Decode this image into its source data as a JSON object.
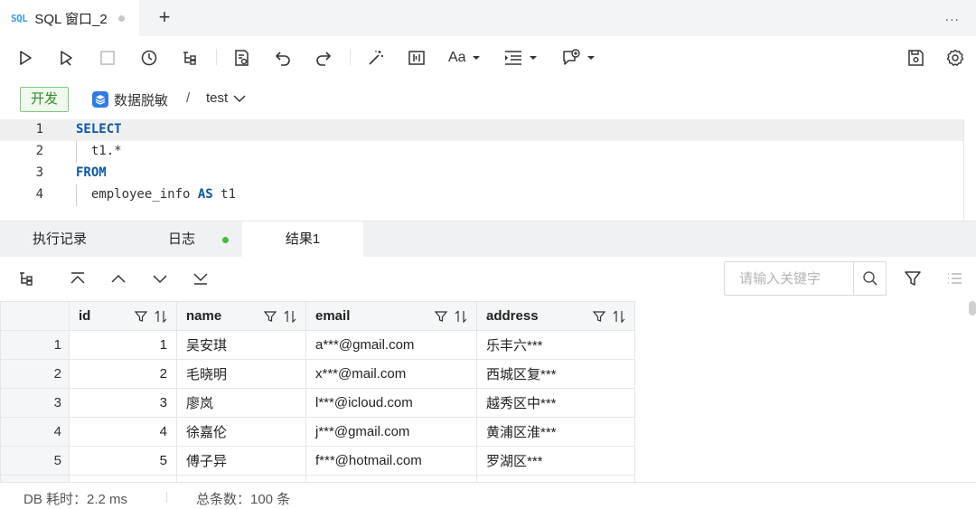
{
  "tab": {
    "badge": "SQL",
    "title": "SQL 窗口_2",
    "new_tab": "+",
    "more": "..."
  },
  "toolbar": {
    "icons": [
      "run-icon",
      "run-selected-icon",
      "stop-icon",
      "history-icon",
      "explain-icon",
      "format-icon",
      "undo-icon",
      "redo-icon",
      "magic-icon",
      "snippet-icon",
      "font-size-icon",
      "indent-icon",
      "comment-icon",
      "save-icon",
      "settings-icon"
    ],
    "font_label": "Aa"
  },
  "context": {
    "env": "开发",
    "database": "数据脱敏",
    "separator": "/",
    "schema": "test"
  },
  "editor": {
    "lines": [
      {
        "n": "1",
        "kw": "SELECT",
        "text": ""
      },
      {
        "n": "2",
        "kw": "",
        "text": "  t1.*"
      },
      {
        "n": "3",
        "kw": "FROM",
        "text": ""
      },
      {
        "n": "4",
        "kw": "",
        "text": "  employee_info ",
        "kw2": "AS",
        "text2": " t1"
      }
    ]
  },
  "panel_tabs": [
    {
      "label": "执行记录"
    },
    {
      "label": "日志"
    },
    {
      "label": "结果1"
    }
  ],
  "search": {
    "placeholder": "请输入关键字"
  },
  "grid": {
    "columns": [
      "id",
      "name",
      "email",
      "address"
    ],
    "rows": [
      {
        "rn": "1",
        "id": "1",
        "name": "吴安琪",
        "email": "a***@gmail.com",
        "address": "乐丰六***"
      },
      {
        "rn": "2",
        "id": "2",
        "name": "毛晓明",
        "email": "x***@mail.com",
        "address": "西城区复***"
      },
      {
        "rn": "3",
        "id": "3",
        "name": "廖岚",
        "email": "l***@icloud.com",
        "address": "越秀区中***"
      },
      {
        "rn": "4",
        "id": "4",
        "name": "徐嘉伦",
        "email": "j***@gmail.com",
        "address": "黄浦区淮***"
      },
      {
        "rn": "5",
        "id": "5",
        "name": "傅子异",
        "email": "f***@hotmail.com",
        "address": "罗湖区***"
      }
    ]
  },
  "status": {
    "db_time": "DB 耗时：2.2 ms",
    "total": "总条数：100 条"
  }
}
